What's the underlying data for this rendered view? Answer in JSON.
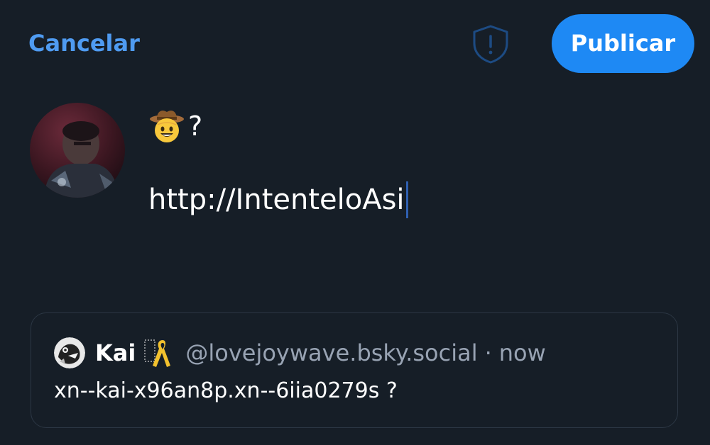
{
  "header": {
    "cancel_label": "Cancelar",
    "publish_label": "Publicar",
    "shield_icon": "shield-alert-icon"
  },
  "composer": {
    "line1_emoji": "cowboy-emoji",
    "line1_text": "?",
    "line2_text": "http://IntenteloAsi"
  },
  "quote": {
    "author_name": "Kai",
    "author_badge": "yellow-ribbon-icon",
    "author_handle": "@lovejoywave.bsky.social",
    "separator": "·",
    "time": "now",
    "text": "xn--kai-x96an8p.xn--6iia0279s ?"
  },
  "colors": {
    "background": "#161e27",
    "accent": "#1e89f4",
    "link": "#4f9bf1",
    "muted_text": "#98a3b3",
    "card_border": "#2c3744"
  }
}
